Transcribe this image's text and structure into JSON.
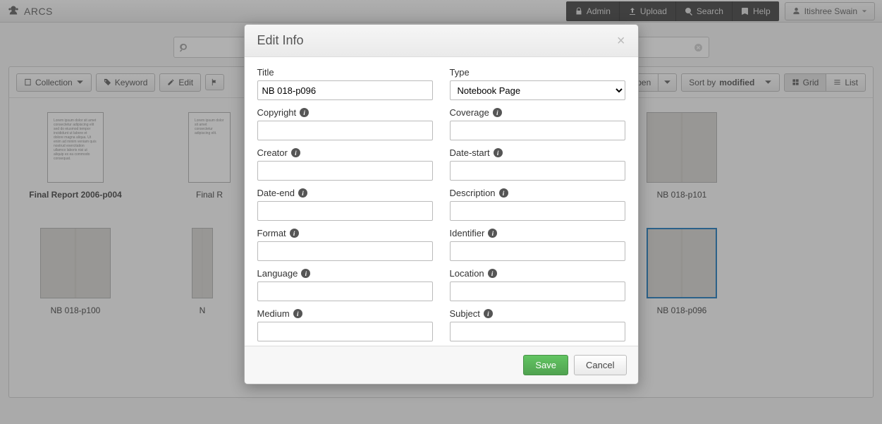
{
  "app": {
    "name": "ARCS"
  },
  "nav": {
    "admin": "Admin",
    "upload": "Upload",
    "search": "Search",
    "help": "Help"
  },
  "user": {
    "name": "Itishree Swain"
  },
  "search": {
    "placeholder": ""
  },
  "toolbar": {
    "collection": "Collection",
    "keyword": "Keyword",
    "edit": "Edit",
    "open": "Open",
    "sort_prefix": "Sort by ",
    "sort_field": "modified",
    "grid": "Grid",
    "list": "List"
  },
  "gallery": {
    "items": [
      {
        "label": "Final Report 2006-p004",
        "kind": "report",
        "bold": true
      },
      {
        "label": "Final R",
        "kind": "report",
        "truncated": true
      },
      {
        "label": "NB 018-p101",
        "kind": "notebook"
      },
      {
        "label": "NB 018-p100",
        "kind": "notebook"
      },
      {
        "label": "N",
        "kind": "notebook",
        "truncated": true
      },
      {
        "label": "NB 018-p096",
        "kind": "notebook",
        "selected": true
      }
    ]
  },
  "modal": {
    "title": "Edit Info",
    "fields": {
      "title": {
        "label": "Title",
        "value": "NB 018-p096",
        "info": false
      },
      "type": {
        "label": "Type",
        "value": "Notebook Page",
        "info": false,
        "select": true
      },
      "copyright": {
        "label": "Copyright",
        "value": "",
        "info": true
      },
      "coverage": {
        "label": "Coverage",
        "value": "",
        "info": true
      },
      "creator": {
        "label": "Creator",
        "value": "",
        "info": true
      },
      "date_start": {
        "label": "Date-start",
        "value": "",
        "info": true
      },
      "date_end": {
        "label": "Date-end",
        "value": "",
        "info": true
      },
      "description": {
        "label": "Description",
        "value": "",
        "info": true
      },
      "format": {
        "label": "Format",
        "value": "",
        "info": true
      },
      "identifier": {
        "label": "Identifier",
        "value": "",
        "info": true
      },
      "language": {
        "label": "Language",
        "value": "",
        "info": true
      },
      "location": {
        "label": "Location",
        "value": "",
        "info": true
      },
      "medium": {
        "label": "Medium",
        "value": "",
        "info": true
      },
      "subject": {
        "label": "Subject",
        "value": "",
        "info": true
      }
    },
    "buttons": {
      "save": "Save",
      "cancel": "Cancel"
    }
  }
}
